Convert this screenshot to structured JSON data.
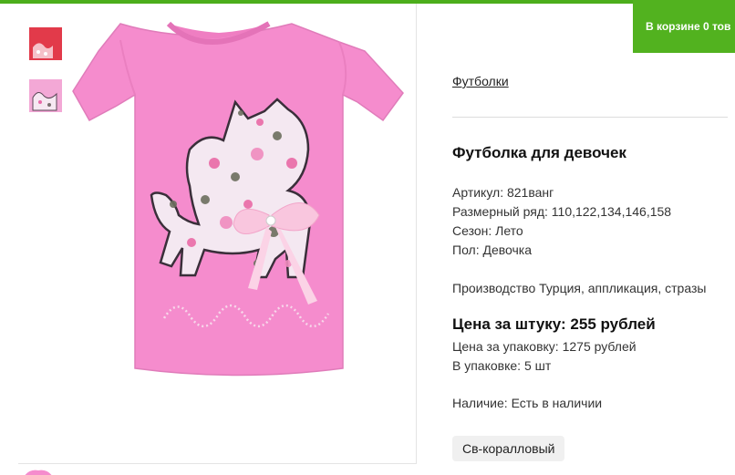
{
  "cart": {
    "label": "В корзине 0 тов"
  },
  "gallery": {
    "thumbnails": [
      {
        "icon": "tshirt-thumbnail-red",
        "color": "#e23a4a"
      },
      {
        "icon": "tshirt-thumbnail-pink",
        "color": "#f3a8d6"
      }
    ],
    "main_image": {
      "icon": "pink-tshirt-with-floral-cat-print",
      "shirt_color": "#f58ccd"
    }
  },
  "product": {
    "category_link": "Футболки",
    "title": "Футболка для девочек",
    "article": "Артикул: 821ванг",
    "size_range": "Размерный ряд: 110,122,134,146,158",
    "season": "Сезон: Лето",
    "gender": "Пол: Девочка",
    "description": "Производство Турция, аппликация, стразы",
    "price_per_item": "Цена за штуку: 255 рублей",
    "price_per_pack": "Цена за упаковку: 1275 рублей",
    "pack_quantity": "В упаковке: 5 шт",
    "availability": "Наличие: Есть в наличии",
    "color_option": "Св-коралловый"
  },
  "colors": {
    "accent_green": "#52b21f",
    "shirt_pink": "#f58ccd"
  }
}
